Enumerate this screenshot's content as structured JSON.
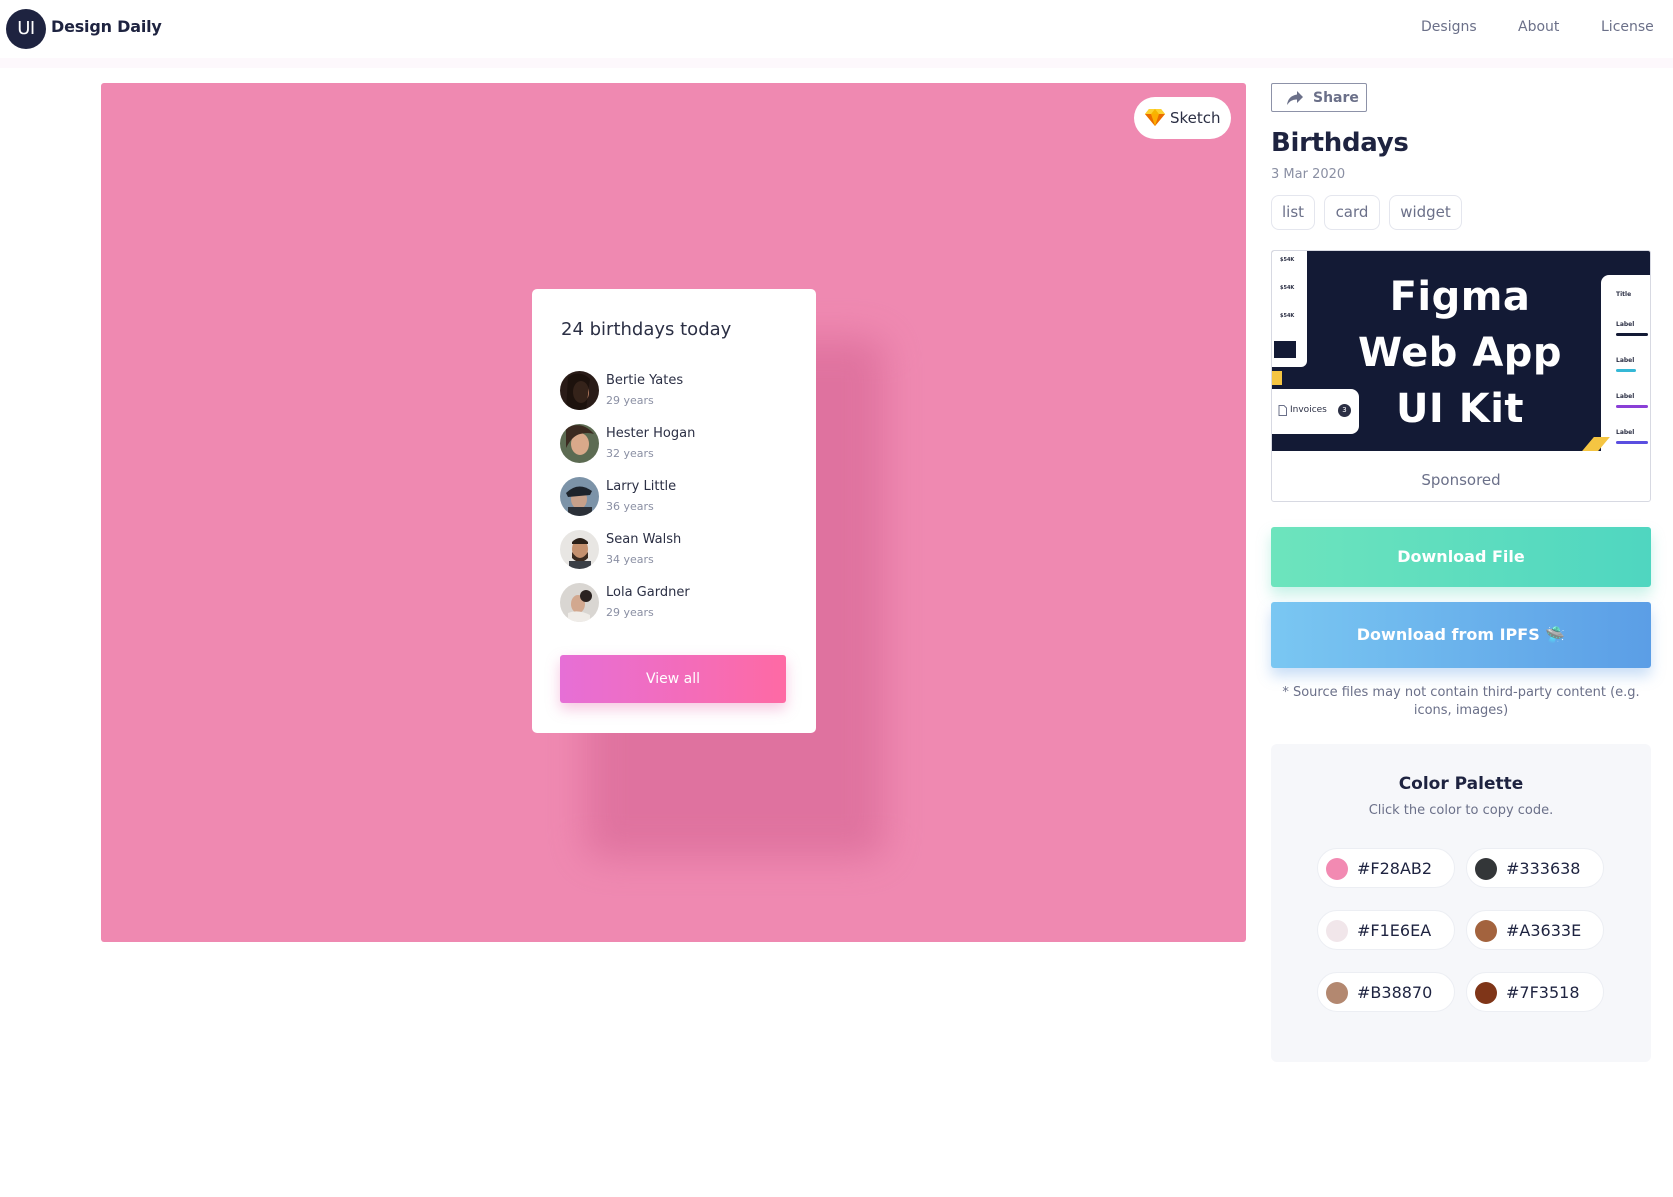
{
  "header": {
    "logo": "UI",
    "brand": "Design Daily",
    "nav": [
      "Designs",
      "About",
      "License"
    ]
  },
  "preview": {
    "badge_label": "Sketch",
    "background": "#F28AB2",
    "card": {
      "title": "24 birthdays today",
      "people": [
        {
          "name": "Bertie Yates",
          "age": "29 years"
        },
        {
          "name": "Hester Hogan",
          "age": "32 years"
        },
        {
          "name": "Larry Little",
          "age": "36 years"
        },
        {
          "name": "Sean Walsh",
          "age": "34 years"
        },
        {
          "name": "Lola Gardner",
          "age": "29 years"
        }
      ],
      "button": "View all"
    }
  },
  "sidebar": {
    "share_label": "Share",
    "title": "Birthdays",
    "date": "3 Mar 2020",
    "tags": [
      "list",
      "card",
      "widget"
    ],
    "ad": {
      "heading_lines": [
        "Figma",
        "Web App",
        "UI Kit"
      ],
      "mini_values": [
        "$54K",
        "$54K",
        "$54K"
      ],
      "invoice_label": "Invoices",
      "invoice_count": "3",
      "right_title": "Title",
      "right_labels": [
        "Label",
        "Label",
        "Label",
        "Label"
      ],
      "sponsored": "Sponsored"
    },
    "download_file": "Download File",
    "download_ipfs": "Download from IPFS 🛸",
    "note": "* Source files may not contain third-party content (e.g. icons, images)",
    "palette": {
      "title": "Color Palette",
      "subtitle": "Click the color to copy code.",
      "colors": [
        "#F28AB2",
        "#333638",
        "#F1E6EA",
        "#A3633E",
        "#B38870",
        "#7F3518"
      ]
    }
  }
}
